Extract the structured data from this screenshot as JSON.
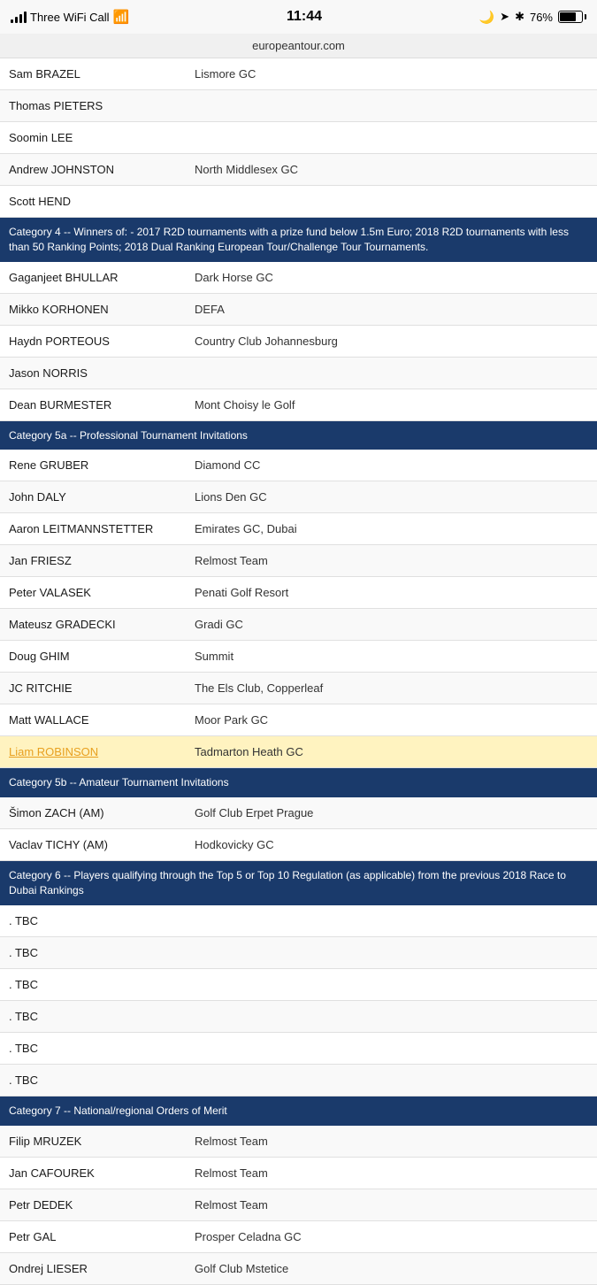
{
  "statusBar": {
    "carrier": "Three WiFi Call",
    "time": "11:44",
    "battery": "76%"
  },
  "urlBar": {
    "url": "europeantour.com"
  },
  "rows": [
    {
      "type": "player",
      "name": "Sam BRAZEL",
      "club": "Lismore GC"
    },
    {
      "type": "player",
      "name": "Thomas PIETERS",
      "club": ""
    },
    {
      "type": "player",
      "name": "Soomin LEE",
      "club": ""
    },
    {
      "type": "player",
      "name": "Andrew JOHNSTON",
      "club": "North Middlesex GC"
    },
    {
      "type": "player",
      "name": "Scott HEND",
      "club": ""
    },
    {
      "type": "category",
      "text": "Category 4 -- Winners of: - 2017 R2D tournaments with a prize fund below 1.5m Euro; 2018 R2D tournaments with less than 50 Ranking Points; 2018 Dual Ranking European Tour/Challenge Tour Tournaments."
    },
    {
      "type": "player",
      "name": "Gaganjeet BHULLAR",
      "club": "Dark Horse GC"
    },
    {
      "type": "player",
      "name": "Mikko KORHONEN",
      "club": "DEFA"
    },
    {
      "type": "player",
      "name": "Haydn PORTEOUS",
      "club": "Country Club Johannesburg"
    },
    {
      "type": "player",
      "name": "Jason NORRIS",
      "club": ""
    },
    {
      "type": "player",
      "name": "Dean BURMESTER",
      "club": "Mont Choisy le Golf"
    },
    {
      "type": "category",
      "text": "Category 5a -- Professional Tournament Invitations"
    },
    {
      "type": "player",
      "name": "Rene GRUBER",
      "club": "Diamond CC"
    },
    {
      "type": "player",
      "name": "John DALY",
      "club": "Lions Den GC"
    },
    {
      "type": "player",
      "name": "Aaron LEITMANNSTETTER",
      "club": "Emirates GC, Dubai"
    },
    {
      "type": "player",
      "name": "Jan FRIESZ",
      "club": "Relmost Team"
    },
    {
      "type": "player",
      "name": "Peter VALASEK",
      "club": "Penati Golf Resort"
    },
    {
      "type": "player",
      "name": "Mateusz GRADECKI",
      "club": "Gradi GC"
    },
    {
      "type": "player",
      "name": "Doug GHIM",
      "club": "Summit"
    },
    {
      "type": "player",
      "name": "JC RITCHIE",
      "club": "The Els Club, Copperleaf"
    },
    {
      "type": "player",
      "name": "Matt WALLACE",
      "club": "Moor Park GC"
    },
    {
      "type": "player",
      "name": "Liam ROBINSON",
      "club": "Tadmarton Heath GC",
      "highlight": true,
      "linkStyle": true
    },
    {
      "type": "category",
      "text": "Category 5b -- Amateur Tournament Invitations"
    },
    {
      "type": "player",
      "name": "Šimon ZACH (AM)",
      "club": "Golf Club Erpet Prague"
    },
    {
      "type": "player",
      "name": "Vaclav TICHY (AM)",
      "club": "Hodkovicky GC"
    },
    {
      "type": "category",
      "text": "Category 6 -- Players qualifying through the Top 5 or Top 10 Regulation (as applicable) from the previous 2018 Race to Dubai Rankings"
    },
    {
      "type": "player",
      "name": ". TBC",
      "club": ""
    },
    {
      "type": "player",
      "name": ". TBC",
      "club": ""
    },
    {
      "type": "player",
      "name": ". TBC",
      "club": ""
    },
    {
      "type": "player",
      "name": ". TBC",
      "club": ""
    },
    {
      "type": "player",
      "name": ". TBC",
      "club": ""
    },
    {
      "type": "player",
      "name": ". TBC",
      "club": ""
    },
    {
      "type": "category",
      "text": "Category 7 -- National/regional Orders of Merit"
    },
    {
      "type": "player",
      "name": "Filip MRUZEK",
      "club": "Relmost Team"
    },
    {
      "type": "player",
      "name": "Jan CAFOUREK",
      "club": "Relmost Team"
    },
    {
      "type": "player",
      "name": "Petr DEDEK",
      "club": "Relmost Team"
    },
    {
      "type": "player",
      "name": "Petr GAL",
      "club": "Prosper Celadna GC"
    },
    {
      "type": "player",
      "name": "Ondrej LIESER",
      "club": "Golf Club Mstetice"
    }
  ]
}
